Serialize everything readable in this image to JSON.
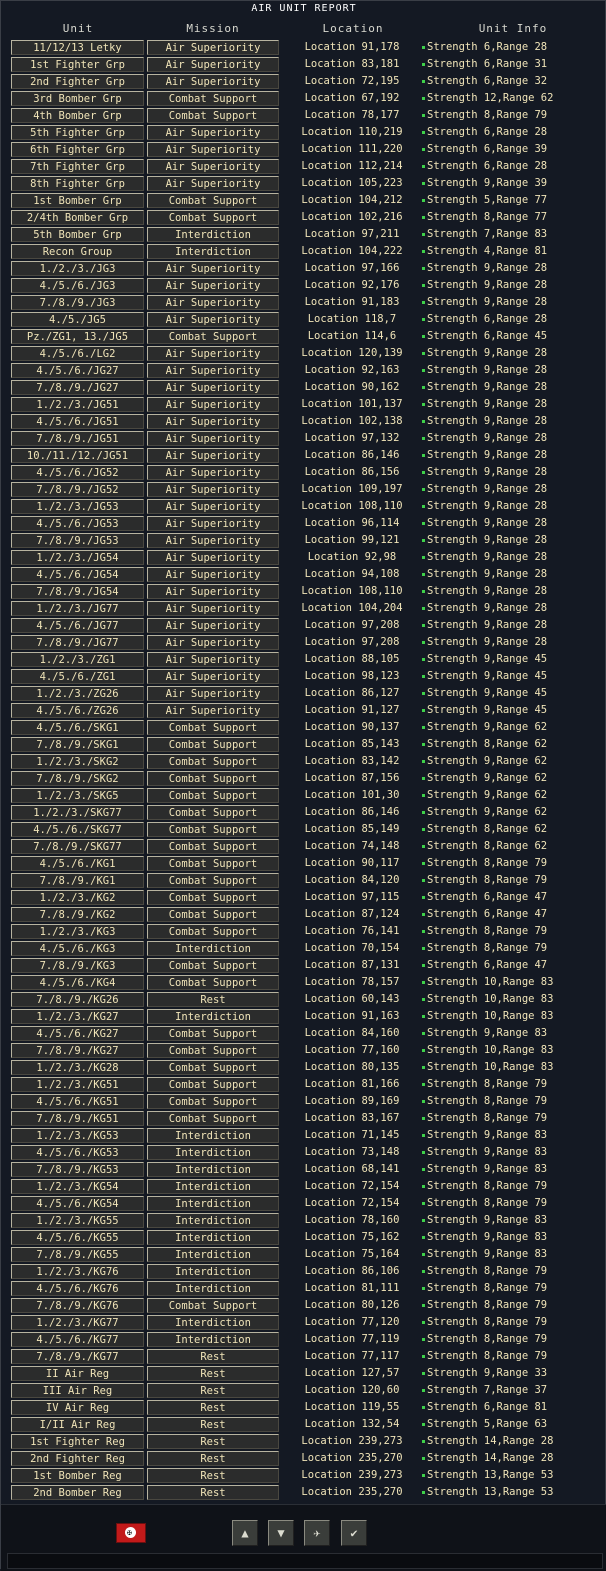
{
  "title": "AIR UNIT REPORT",
  "headers": {
    "unit": "Unit",
    "mission": "Mission",
    "location": "Location",
    "info": "Unit Info"
  },
  "rows": [
    [
      "11/12/13 Letky",
      "Air Superiority",
      "Location 91,178",
      "Strength 6,Range 28"
    ],
    [
      "1st Fighter Grp",
      "Air Superiority",
      "Location 83,181",
      "Strength 6,Range 31"
    ],
    [
      "2nd Fighter Grp",
      "Air Superiority",
      "Location 72,195",
      "Strength 6,Range 32"
    ],
    [
      "3rd Bomber Grp",
      "Combat Support",
      "Location 67,192",
      "Strength 12,Range 62"
    ],
    [
      "4th Bomber Grp",
      "Combat Support",
      "Location 78,177",
      "Strength 8,Range 79"
    ],
    [
      "5th Fighter Grp",
      "Air Superiority",
      "Location 110,219",
      "Strength 6,Range 28"
    ],
    [
      "6th Fighter Grp",
      "Air Superiority",
      "Location 111,220",
      "Strength 6,Range 39"
    ],
    [
      "7th Fighter Grp",
      "Air Superiority",
      "Location 112,214",
      "Strength 6,Range 28"
    ],
    [
      "8th Fighter Grp",
      "Air Superiority",
      "Location 105,223",
      "Strength 9,Range 39"
    ],
    [
      "1st Bomber Grp",
      "Combat Support",
      "Location 104,212",
      "Strength 5,Range 77"
    ],
    [
      "2/4th Bomber Grp",
      "Combat Support",
      "Location 102,216",
      "Strength 8,Range 77"
    ],
    [
      "5th Bomber Grp",
      "Interdiction",
      "Location 97,211",
      "Strength 7,Range 83"
    ],
    [
      "Recon Group",
      "Interdiction",
      "Location 104,222",
      "Strength 4,Range 81"
    ],
    [
      "1./2./3./JG3",
      "Air Superiority",
      "Location 97,166",
      "Strength 9,Range 28"
    ],
    [
      "4./5./6./JG3",
      "Air Superiority",
      "Location 92,176",
      "Strength 9,Range 28"
    ],
    [
      "7./8./9./JG3",
      "Air Superiority",
      "Location 91,183",
      "Strength 9,Range 28"
    ],
    [
      "4./5./JG5",
      "Air Superiority",
      "Location 118,7",
      "Strength 6,Range 28"
    ],
    [
      "Pz./ZG1, 13./JG5",
      "Combat Support",
      "Location 114,6",
      "Strength 6,Range 45"
    ],
    [
      "4./5./6./LG2",
      "Air Superiority",
      "Location 120,139",
      "Strength 9,Range 28"
    ],
    [
      "4./5./6./JG27",
      "Air Superiority",
      "Location 92,163",
      "Strength 9,Range 28"
    ],
    [
      "7./8./9./JG27",
      "Air Superiority",
      "Location 90,162",
      "Strength 9,Range 28"
    ],
    [
      "1./2./3./JG51",
      "Air Superiority",
      "Location 101,137",
      "Strength 9,Range 28"
    ],
    [
      "4./5./6./JG51",
      "Air Superiority",
      "Location 102,138",
      "Strength 9,Range 28"
    ],
    [
      "7./8./9./JG51",
      "Air Superiority",
      "Location 97,132",
      "Strength 9,Range 28"
    ],
    [
      "10./11./12./JG51",
      "Air Superiority",
      "Location 86,146",
      "Strength 9,Range 28"
    ],
    [
      "4./5./6./JG52",
      "Air Superiority",
      "Location 86,156",
      "Strength 9,Range 28"
    ],
    [
      "7./8./9./JG52",
      "Air Superiority",
      "Location 109,197",
      "Strength 9,Range 28"
    ],
    [
      "1./2./3./JG53",
      "Air Superiority",
      "Location 108,110",
      "Strength 9,Range 28"
    ],
    [
      "4./5./6./JG53",
      "Air Superiority",
      "Location 96,114",
      "Strength 9,Range 28"
    ],
    [
      "7./8./9./JG53",
      "Air Superiority",
      "Location 99,121",
      "Strength 9,Range 28"
    ],
    [
      "1./2./3./JG54",
      "Air Superiority",
      "Location 92,98",
      "Strength 9,Range 28"
    ],
    [
      "4./5./6./JG54",
      "Air Superiority",
      "Location 94,108",
      "Strength 9,Range 28"
    ],
    [
      "7./8./9./JG54",
      "Air Superiority",
      "Location 108,110",
      "Strength 9,Range 28"
    ],
    [
      "1./2./3./JG77",
      "Air Superiority",
      "Location 104,204",
      "Strength 9,Range 28"
    ],
    [
      "4./5./6./JG77",
      "Air Superiority",
      "Location 97,208",
      "Strength 9,Range 28"
    ],
    [
      "7./8./9./JG77",
      "Air Superiority",
      "Location 97,208",
      "Strength 9,Range 28"
    ],
    [
      "1./2./3./ZG1",
      "Air Superiority",
      "Location 88,105",
      "Strength 9,Range 45"
    ],
    [
      "4./5./6./ZG1",
      "Air Superiority",
      "Location 98,123",
      "Strength 9,Range 45"
    ],
    [
      "1./2./3./ZG26",
      "Air Superiority",
      "Location 86,127",
      "Strength 9,Range 45"
    ],
    [
      "4./5./6./ZG26",
      "Air Superiority",
      "Location 91,127",
      "Strength 9,Range 45"
    ],
    [
      "4./5./6./SKG1",
      "Combat Support",
      "Location 90,137",
      "Strength 9,Range 62"
    ],
    [
      "7./8./9./SKG1",
      "Combat Support",
      "Location 85,143",
      "Strength 8,Range 62"
    ],
    [
      "1./2./3./SKG2",
      "Combat Support",
      "Location 83,142",
      "Strength 9,Range 62"
    ],
    [
      "7./8./9./SKG2",
      "Combat Support",
      "Location 87,156",
      "Strength 9,Range 62"
    ],
    [
      "1./2./3./SKG5",
      "Combat Support",
      "Location 101,30",
      "Strength 9,Range 62"
    ],
    [
      "1./2./3./SKG77",
      "Combat Support",
      "Location 86,146",
      "Strength 9,Range 62"
    ],
    [
      "4./5./6./SKG77",
      "Combat Support",
      "Location 85,149",
      "Strength 8,Range 62"
    ],
    [
      "7./8./9./SKG77",
      "Combat Support",
      "Location 74,148",
      "Strength 8,Range 62"
    ],
    [
      "4./5./6./KG1",
      "Combat Support",
      "Location 90,117",
      "Strength 8,Range 79"
    ],
    [
      "7./8./9./KG1",
      "Combat Support",
      "Location 84,120",
      "Strength 8,Range 79"
    ],
    [
      "1./2./3./KG2",
      "Combat Support",
      "Location 97,115",
      "Strength 6,Range 47"
    ],
    [
      "7./8./9./KG2",
      "Combat Support",
      "Location 87,124",
      "Strength 6,Range 47"
    ],
    [
      "1./2./3./KG3",
      "Combat Support",
      "Location 76,141",
      "Strength 8,Range 79"
    ],
    [
      "4./5./6./KG3",
      "Interdiction",
      "Location 70,154",
      "Strength 8,Range 79"
    ],
    [
      "7./8./9./KG3",
      "Combat Support",
      "Location 87,131",
      "Strength 6,Range 47"
    ],
    [
      "4./5./6./KG4",
      "Combat Support",
      "Location 78,157",
      "Strength 10,Range 83"
    ],
    [
      "7./8./9./KG26",
      "Rest",
      "Location 60,143",
      "Strength 10,Range 83"
    ],
    [
      "1./2./3./KG27",
      "Interdiction",
      "Location 91,163",
      "Strength 10,Range 83"
    ],
    [
      "4./5./6./KG27",
      "Combat Support",
      "Location 84,160",
      "Strength 9,Range 83"
    ],
    [
      "7./8./9./KG27",
      "Combat Support",
      "Location 77,160",
      "Strength 10,Range 83"
    ],
    [
      "1./2./3./KG28",
      "Combat Support",
      "Location 80,135",
      "Strength 10,Range 83"
    ],
    [
      "1./2./3./KG51",
      "Combat Support",
      "Location 81,166",
      "Strength 8,Range 79"
    ],
    [
      "4./5./6./KG51",
      "Combat Support",
      "Location 89,169",
      "Strength 8,Range 79"
    ],
    [
      "7./8./9./KG51",
      "Combat Support",
      "Location 83,167",
      "Strength 8,Range 79"
    ],
    [
      "1./2./3./KG53",
      "Interdiction",
      "Location 71,145",
      "Strength 9,Range 83"
    ],
    [
      "4./5./6./KG53",
      "Interdiction",
      "Location 73,148",
      "Strength 9,Range 83"
    ],
    [
      "7./8./9./KG53",
      "Interdiction",
      "Location 68,141",
      "Strength 9,Range 83"
    ],
    [
      "1./2./3./KG54",
      "Interdiction",
      "Location 72,154",
      "Strength 8,Range 79"
    ],
    [
      "4./5./6./KG54",
      "Interdiction",
      "Location 72,154",
      "Strength 8,Range 79"
    ],
    [
      "1./2./3./KG55",
      "Interdiction",
      "Location 78,160",
      "Strength 9,Range 83"
    ],
    [
      "4./5./6./KG55",
      "Interdiction",
      "Location 75,162",
      "Strength 9,Range 83"
    ],
    [
      "7./8./9./KG55",
      "Interdiction",
      "Location 75,164",
      "Strength 9,Range 83"
    ],
    [
      "1./2./3./KG76",
      "Interdiction",
      "Location 86,106",
      "Strength 8,Range 79"
    ],
    [
      "4./5./6./KG76",
      "Interdiction",
      "Location 81,111",
      "Strength 8,Range 79"
    ],
    [
      "7./8./9./KG76",
      "Combat Support",
      "Location 80,126",
      "Strength 8,Range 79"
    ],
    [
      "1./2./3./KG77",
      "Interdiction",
      "Location 77,120",
      "Strength 8,Range 79"
    ],
    [
      "4./5./6./KG77",
      "Interdiction",
      "Location 77,119",
      "Strength 8,Range 79"
    ],
    [
      "7./8./9./KG77",
      "Rest",
      "Location 77,117",
      "Strength 8,Range 79"
    ],
    [
      "II Air Reg",
      "Rest",
      "Location 127,57",
      "Strength 9,Range 33"
    ],
    [
      "III Air Reg",
      "Rest",
      "Location 120,60",
      "Strength 7,Range 37"
    ],
    [
      "IV Air Reg",
      "Rest",
      "Location 119,55",
      "Strength 6,Range 81"
    ],
    [
      "I/II Air Reg",
      "Rest",
      "Location 132,54",
      "Strength 5,Range 63"
    ],
    [
      "1st Fighter Reg",
      "Rest",
      "Location 239,273",
      "Strength 14,Range 28"
    ],
    [
      "2nd Fighter Reg",
      "Rest",
      "Location 235,270",
      "Strength 14,Range 28"
    ],
    [
      "1st Bomber Reg",
      "Rest",
      "Location 239,273",
      "Strength 13,Range 53"
    ],
    [
      "2nd Bomber Reg",
      "Rest",
      "Location 235,270",
      "Strength 13,Range 53"
    ]
  ],
  "footer": {
    "flag_icon": "nation-flag-icon",
    "buttons": [
      {
        "name": "scroll-up-button",
        "icon": "up-arrow-icon",
        "glyph": "▲"
      },
      {
        "name": "scroll-down-button",
        "icon": "down-arrow-icon",
        "glyph": "▼"
      },
      {
        "name": "air-unit-button",
        "icon": "airplane-icon",
        "glyph": "✈"
      },
      {
        "name": "confirm-button",
        "icon": "checkmark-icon",
        "glyph": "✔"
      }
    ]
  },
  "colors": {
    "background": "#141923",
    "text": "#f0e4b8",
    "status_dot": "#3fd14a"
  }
}
